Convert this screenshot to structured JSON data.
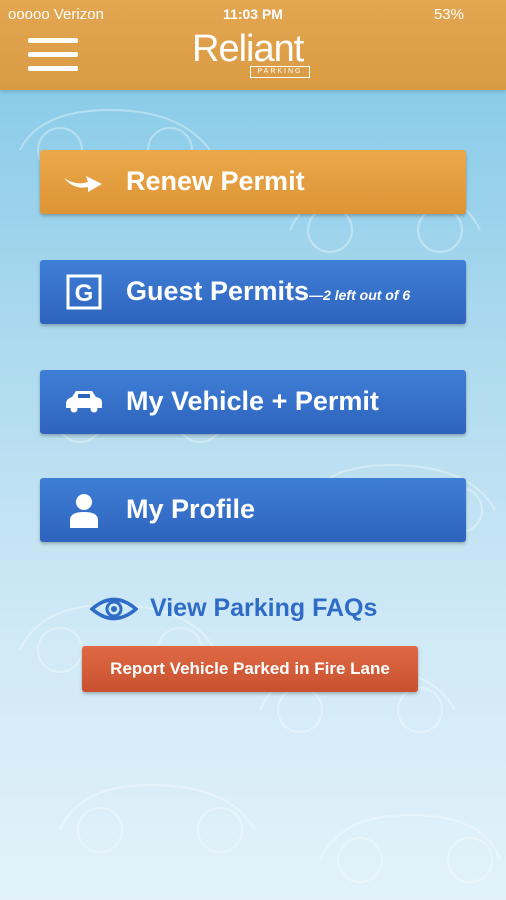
{
  "status_bar": {
    "carrier": "ooooo Verizon",
    "time": "11:03 PM",
    "battery": "53%"
  },
  "header": {
    "logo_text": "Reliant",
    "logo_subtext": "PARKING",
    "menu_icon": "hamburger-menu-icon"
  },
  "actions": {
    "renew_permit": {
      "label": "Renew Permit",
      "icon": "arrow-swoosh-icon",
      "color": "#e29e40"
    },
    "guest_permits": {
      "label": "Guest Permits",
      "sublabel": "—2 left out of 6",
      "icon": "guest-g-icon",
      "color": "#3471c8"
    },
    "my_vehicle": {
      "label": "My Vehicle + Permit",
      "icon": "car-icon",
      "color": "#3471c8"
    },
    "my_profile": {
      "label": "My Profile",
      "icon": "person-icon",
      "color": "#3471c8"
    }
  },
  "faq": {
    "label": "View Parking FAQs",
    "icon": "eye-icon",
    "color": "#2f6cc7"
  },
  "report": {
    "label": "Report Vehicle Parked in Fire Lane",
    "color": "#d45b38"
  }
}
